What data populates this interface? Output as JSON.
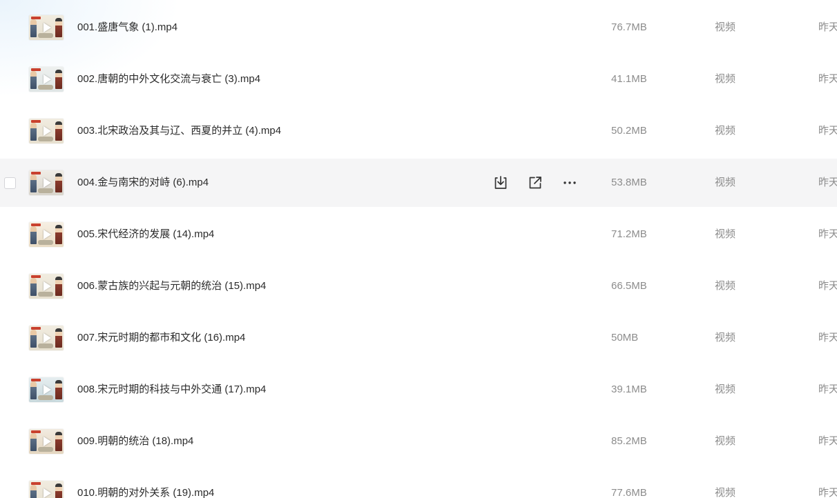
{
  "hovered_row": 3,
  "actions": [
    {
      "icon": "download-icon"
    },
    {
      "icon": "share-icon"
    },
    {
      "icon": "more-icon"
    }
  ],
  "rows": [
    {
      "name": "001.盛唐气象 (1).mp4",
      "size": "76.7MB",
      "type": "视频",
      "date": "昨天"
    },
    {
      "name": "002.唐朝的中外文化交流与衰亡 (3).mp4",
      "size": "41.1MB",
      "type": "视频",
      "date": "昨天"
    },
    {
      "name": "003.北宋政治及其与辽、西夏的并立 (4).mp4",
      "size": "50.2MB",
      "type": "视频",
      "date": "昨天"
    },
    {
      "name": "004.金与南宋的对峙 (6).mp4",
      "size": "53.8MB",
      "type": "视频",
      "date": "昨天"
    },
    {
      "name": "005.宋代经济的发展 (14).mp4",
      "size": "71.2MB",
      "type": "视频",
      "date": "昨天"
    },
    {
      "name": "006.蒙古族的兴起与元朝的统治 (15).mp4",
      "size": "66.5MB",
      "type": "视频",
      "date": "昨天"
    },
    {
      "name": "007.宋元时期的都市和文化 (16).mp4",
      "size": "50MB",
      "type": "视频",
      "date": "昨天"
    },
    {
      "name": "008.宋元时期的科技与中外交通 (17).mp4",
      "size": "39.1MB",
      "type": "视频",
      "date": "昨天"
    },
    {
      "name": "009.明朝的统治 (18).mp4",
      "size": "85.2MB",
      "type": "视频",
      "date": "昨天"
    },
    {
      "name": "010.明朝的对外关系 (19).mp4",
      "size": "77.6MB",
      "type": "视频",
      "date": "昨天"
    }
  ]
}
